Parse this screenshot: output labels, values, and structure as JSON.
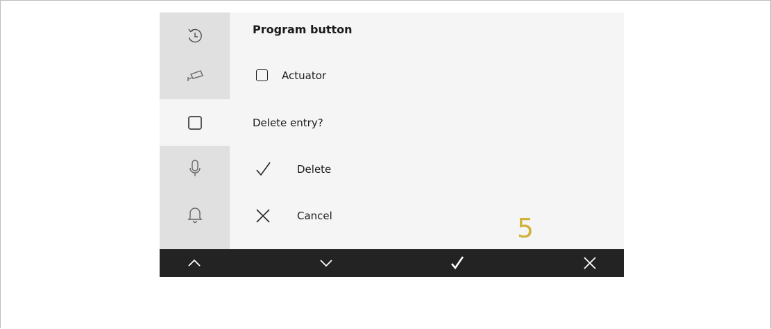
{
  "screen": {
    "title": "Program button",
    "checkbox_label": "Actuator",
    "prompt": "Delete entry?",
    "delete_label": "Delete",
    "cancel_label": "Cancel"
  },
  "annotation": {
    "step": "5"
  },
  "sidebar": {
    "items": [
      {
        "icon": "history-icon"
      },
      {
        "icon": "camera-icon"
      },
      {
        "icon": "square-icon",
        "active": true
      },
      {
        "icon": "microphone-icon"
      },
      {
        "icon": "bell-icon"
      }
    ]
  },
  "bottom_bar": {
    "buttons": [
      {
        "icon": "chevron-up-icon"
      },
      {
        "icon": "chevron-down-icon"
      },
      {
        "icon": "checkmark-icon"
      },
      {
        "icon": "close-icon"
      }
    ]
  },
  "colors": {
    "background": "#f5f5f5",
    "sidebar": "#e0e0e0",
    "bottom_bar": "#232323",
    "annotation": "#d2b23b"
  }
}
